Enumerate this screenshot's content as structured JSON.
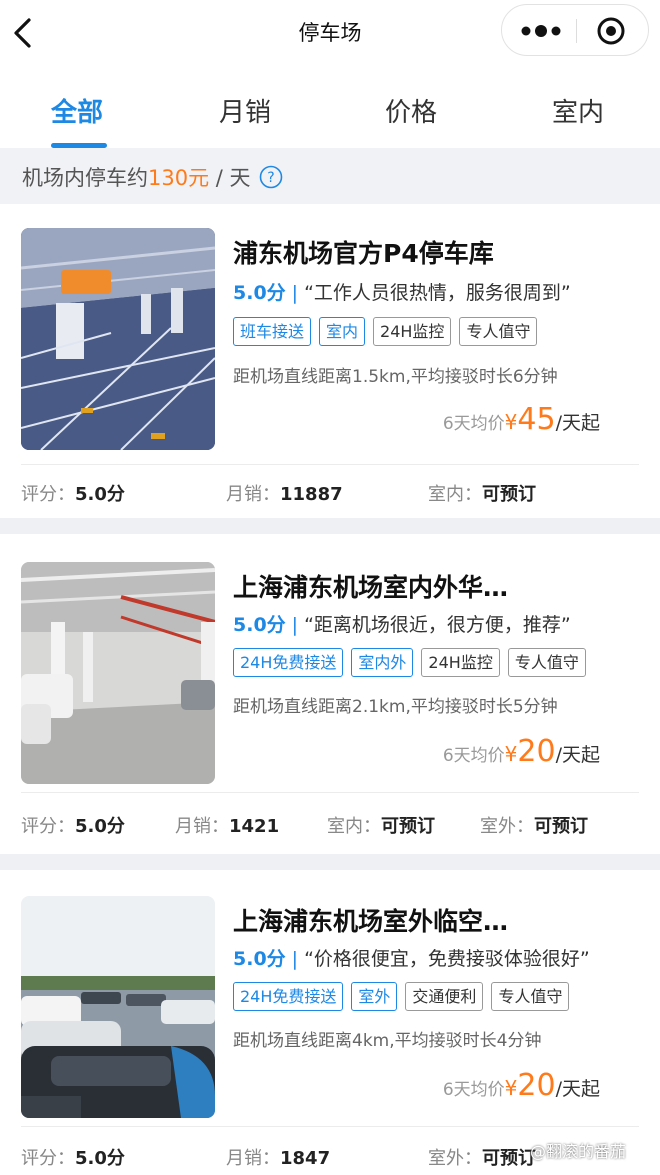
{
  "nav": {
    "title": "停车场"
  },
  "tabs": [
    {
      "label": "全部",
      "active": true
    },
    {
      "label": "月销"
    },
    {
      "label": "价格"
    },
    {
      "label": "室内"
    }
  ],
  "notice": {
    "prefix": "机场内停车约",
    "price": "130元",
    "suffix": " / 天"
  },
  "colors": {
    "accent": "#1e88e5",
    "price": "#ff7a1a"
  },
  "listings": [
    {
      "title": "浦东机场官方P4停车库",
      "score": "5.0分",
      "review": "“工作人员很热情，服务很周到”",
      "tags": [
        {
          "text": "班车接送",
          "blue": true
        },
        {
          "text": "室内",
          "blue": true
        },
        {
          "text": "24H监控",
          "blue": false
        },
        {
          "text": "专人值守",
          "blue": false
        }
      ],
      "distance": "距机场直线距离1.5km,平均接驳时长6分钟",
      "price_prefix": "6天均价",
      "currency": "¥",
      "price": "45",
      "price_suffix": "/天起",
      "stats": [
        {
          "k": "评分：",
          "v": "5.0分"
        },
        {
          "k": "月销：",
          "v": "11887"
        },
        {
          "k": "室内：",
          "v": "可预订"
        }
      ]
    },
    {
      "title": "上海浦东机场室内外华…",
      "score": "5.0分",
      "review": "“距离机场很近，很方便，推荐”",
      "tags": [
        {
          "text": "24H免费接送",
          "blue": true
        },
        {
          "text": "室内外",
          "blue": true
        },
        {
          "text": "24H监控",
          "blue": false
        },
        {
          "text": "专人值守",
          "blue": false
        }
      ],
      "distance": "距机场直线距离2.1km,平均接驳时长5分钟",
      "price_prefix": "6天均价",
      "currency": "¥",
      "price": "20",
      "price_suffix": "/天起",
      "stats": [
        {
          "k": "评分：",
          "v": "5.0分"
        },
        {
          "k": "月销：",
          "v": "1421"
        },
        {
          "k": "室内：",
          "v": "可预订"
        },
        {
          "k": "室外：",
          "v": "可预订"
        }
      ]
    },
    {
      "title": "上海浦东机场室外临空…",
      "score": "5.0分",
      "review": "“价格很便宜，免费接驳体验很好”",
      "tags": [
        {
          "text": "24H免费接送",
          "blue": true
        },
        {
          "text": "室外",
          "blue": true
        },
        {
          "text": "交通便利",
          "blue": false
        },
        {
          "text": "专人值守",
          "blue": false
        }
      ],
      "distance": "距机场直线距离4km,平均接驳时长4分钟",
      "price_prefix": "6天均价",
      "currency": "¥",
      "price": "20",
      "price_suffix": "/天起",
      "stats": [
        {
          "k": "评分：",
          "v": "5.0分"
        },
        {
          "k": "月销：",
          "v": "1847"
        },
        {
          "k": "室外：",
          "v": "可预订"
        }
      ]
    }
  ],
  "watermark": "@翻滚的番茄"
}
